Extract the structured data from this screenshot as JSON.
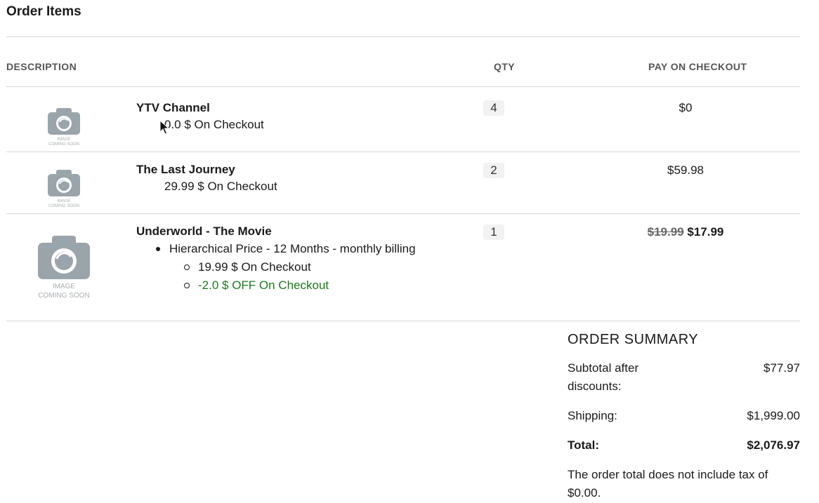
{
  "section_title": "Order Items",
  "columns": {
    "description": "DESCRIPTION",
    "qty": "QTY",
    "pay": "PAY ON CHECKOUT"
  },
  "thumbnail": {
    "line1": "IMAGE",
    "line2": "COMING SOON"
  },
  "items": [
    {
      "name": "YTV Channel",
      "sub": "0.0 $ On Checkout",
      "qty": "4",
      "pay": "$0"
    },
    {
      "name": "The Last Journey",
      "sub": "29.99 $ On Checkout",
      "qty": "2",
      "pay": "$59.98"
    },
    {
      "name": "Underworld - The Movie",
      "plan": "Hierarchical Price - 12 Months - monthly billing",
      "price_line": "19.99 $ On Checkout",
      "discount_line": "-2.0 $ OFF On Checkout",
      "qty": "1",
      "pay_original": "$19.99",
      "pay": "$17.99"
    }
  ],
  "summary": {
    "title": "ORDER SUMMARY",
    "subtotal_label_1": "Subtotal after",
    "subtotal_label_2": "discounts:",
    "subtotal_value": "$77.97",
    "shipping_label": "Shipping:",
    "shipping_value": "$1,999.00",
    "total_label": "Total:",
    "total_value": "$2,076.97",
    "tax_note_1": "The order total does not include tax of",
    "tax_note_2": "$0.00."
  },
  "colors": {
    "discount_green": "#1c7a1c",
    "divider": "#d6d6d6",
    "header_gray": "#555555"
  }
}
